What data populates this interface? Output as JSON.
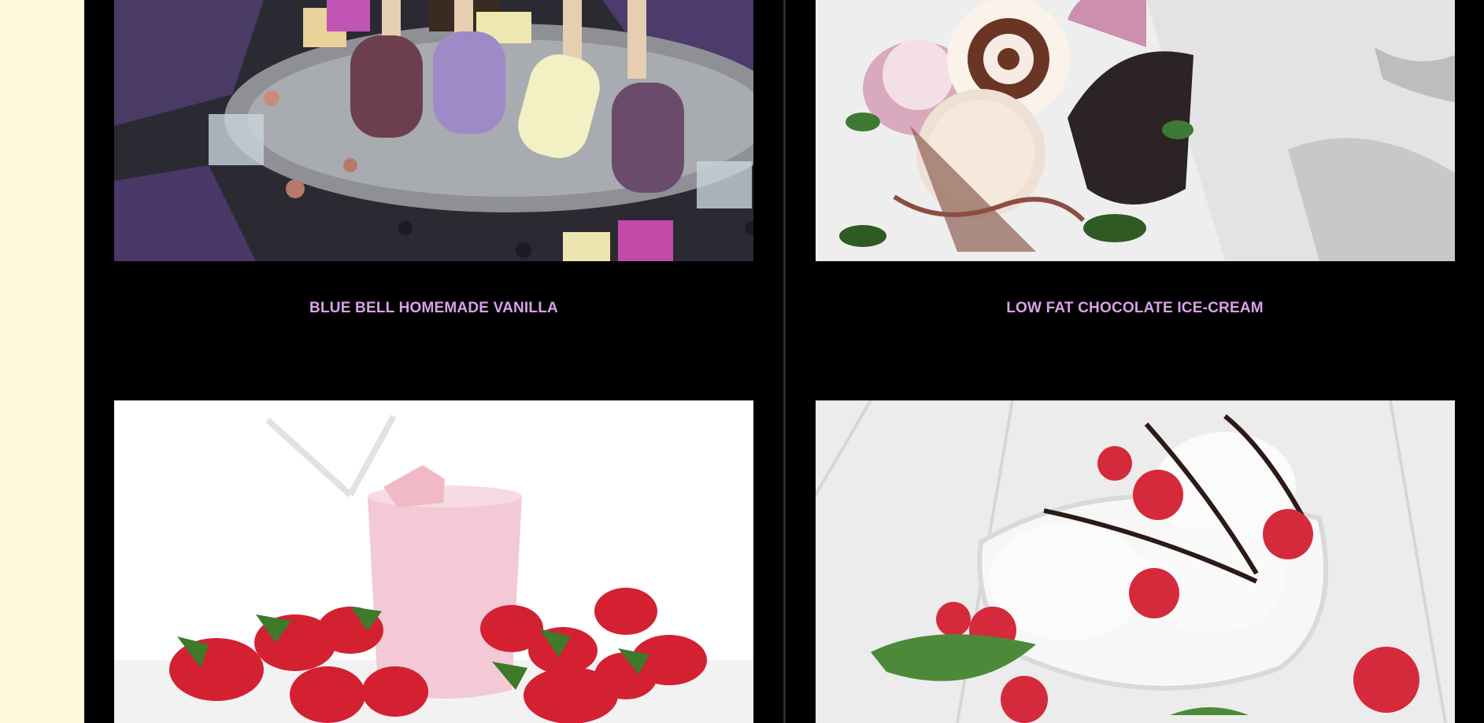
{
  "products": [
    {
      "name": "BLUE BELL HOMEMADE VANILLA",
      "image": "popsicles-on-ice-tray"
    },
    {
      "name": "LOW FAT CHOCOLATE ICE-CREAM",
      "image": "ice-cream-cones-stand"
    },
    {
      "name": "",
      "image": "strawberry-milkshake-glass"
    },
    {
      "name": "",
      "image": "vanilla-ice-cream-raspberries-bowl"
    }
  ],
  "colors": {
    "background": "#000000",
    "side_panel": "#fdf8dc",
    "caption": "#d9a2e8"
  }
}
